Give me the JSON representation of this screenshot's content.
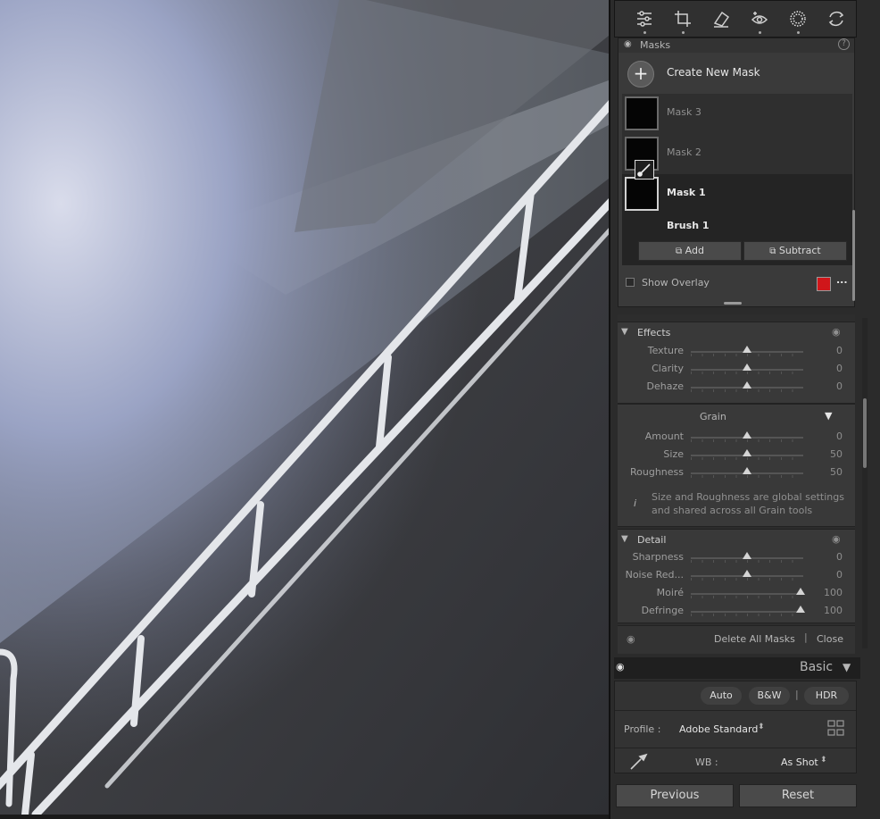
{
  "toolbar": {
    "tools": [
      {
        "icon": "edit-sliders-icon"
      },
      {
        "icon": "crop-icon"
      },
      {
        "icon": "healing-eraser-icon"
      },
      {
        "icon": "red-eye-icon"
      },
      {
        "icon": "masking-icon"
      },
      {
        "icon": "presets-icon"
      }
    ]
  },
  "masks": {
    "title": "Masks",
    "create_label": "Create New Mask",
    "items": [
      {
        "name": "Mask 3",
        "selected": false
      },
      {
        "name": "Mask 2",
        "selected": false
      },
      {
        "name": "Mask 1",
        "selected": true
      }
    ],
    "component": "Brush 1",
    "add_label": "Add",
    "subtract_label": "Subtract",
    "show_overlay_label": "Show Overlay",
    "overlay_color": "#d0161a",
    "more_label": "..."
  },
  "effects": {
    "title": "Effects",
    "sliders": [
      {
        "label": "Texture",
        "value": "0",
        "fraction": 0.5
      },
      {
        "label": "Clarity",
        "value": "0",
        "fraction": 0.5
      },
      {
        "label": "Dehaze",
        "value": "0",
        "fraction": 0.5
      }
    ]
  },
  "grain": {
    "title": "Grain",
    "sliders": [
      {
        "label": "Amount",
        "value": "0",
        "fraction": 0.5
      },
      {
        "label": "Size",
        "value": "50",
        "fraction": 0.5
      },
      {
        "label": "Roughness",
        "value": "50",
        "fraction": 0.5
      }
    ],
    "info": "Size and Roughness are global settings and shared across all Grain tools"
  },
  "detail": {
    "title": "Detail",
    "sliders": [
      {
        "label": "Sharpness",
        "value": "0",
        "fraction": 0.5
      },
      {
        "label": "Noise Red...",
        "value": "0",
        "fraction": 0.5
      },
      {
        "label": "Moiré",
        "value": "100",
        "fraction": 1.0
      },
      {
        "label": "Defringe",
        "value": "100",
        "fraction": 1.0
      }
    ]
  },
  "footer": {
    "delete_all": "Delete All Masks",
    "close": "Close"
  },
  "basic": {
    "title": "Basic",
    "auto": "Auto",
    "bw": "B&W",
    "hdr": "HDR",
    "profile_label": "Profile :",
    "profile_value": "Adobe Standard",
    "wb_label": "WB :",
    "wb_value": "As Shot"
  },
  "bottom": {
    "previous": "Previous",
    "reset": "Reset"
  }
}
